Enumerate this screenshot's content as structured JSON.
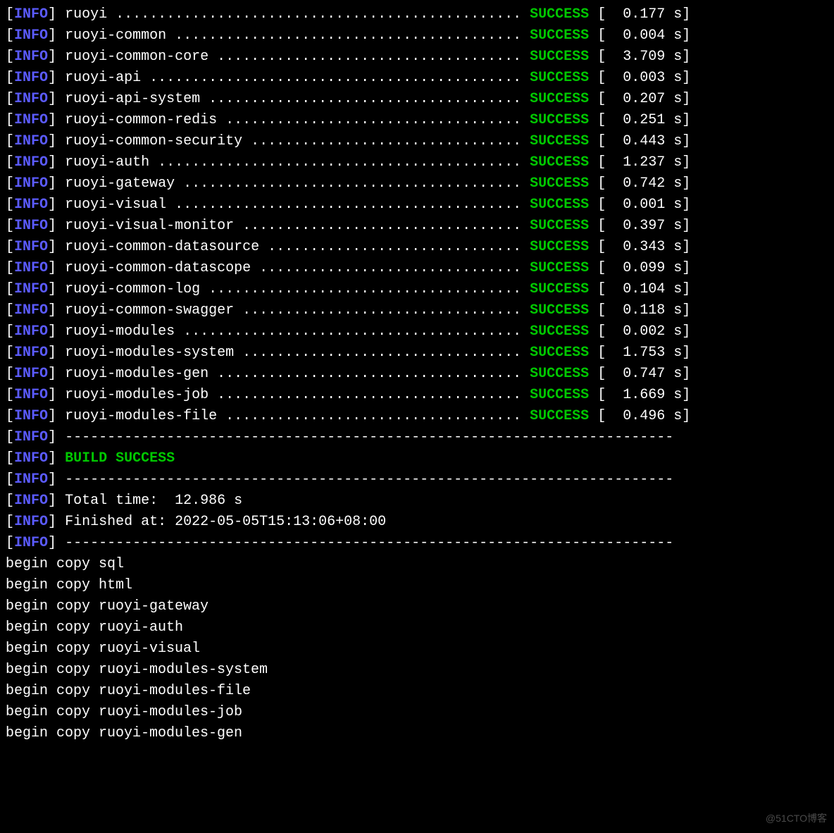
{
  "labels": {
    "info": "INFO",
    "success": "SUCCESS",
    "open": "[",
    "close": "]",
    "s": "s"
  },
  "modules": [
    {
      "name": "ruoyi",
      "time": "0.177"
    },
    {
      "name": "ruoyi-common",
      "time": "0.004"
    },
    {
      "name": "ruoyi-common-core",
      "time": "3.709"
    },
    {
      "name": "ruoyi-api",
      "time": "0.003"
    },
    {
      "name": "ruoyi-api-system",
      "time": "0.207"
    },
    {
      "name": "ruoyi-common-redis",
      "time": "0.251"
    },
    {
      "name": "ruoyi-common-security",
      "time": "0.443"
    },
    {
      "name": "ruoyi-auth",
      "time": "1.237"
    },
    {
      "name": "ruoyi-gateway",
      "time": "0.742"
    },
    {
      "name": "ruoyi-visual",
      "time": "0.001"
    },
    {
      "name": "ruoyi-visual-monitor",
      "time": "0.397"
    },
    {
      "name": "ruoyi-common-datasource",
      "time": "0.343"
    },
    {
      "name": "ruoyi-common-datascope",
      "time": "0.099"
    },
    {
      "name": "ruoyi-common-log",
      "time": "0.104"
    },
    {
      "name": "ruoyi-common-swagger",
      "time": "0.118"
    },
    {
      "name": "ruoyi-modules",
      "time": "0.002"
    },
    {
      "name": "ruoyi-modules-system",
      "time": "1.753"
    },
    {
      "name": "ruoyi-modules-gen",
      "time": "0.747"
    },
    {
      "name": "ruoyi-modules-job",
      "time": "1.669"
    },
    {
      "name": "ruoyi-modules-file",
      "time": "0.496"
    }
  ],
  "summary": {
    "rule": "------------------------------------------------------------------------",
    "build_success": "BUILD SUCCESS",
    "total_time_label": "Total time:  ",
    "total_time_value": "12.986 s",
    "finished_label": "Finished at: ",
    "finished_value": "2022-05-05T15:13:06+08:00"
  },
  "copy_lines": [
    "begin copy sql",
    "begin copy html",
    "begin copy ruoyi-gateway",
    "begin copy ruoyi-auth",
    "begin copy ruoyi-visual",
    "begin copy ruoyi-modules-system",
    "begin copy ruoyi-modules-file",
    "begin copy ruoyi-modules-job",
    "begin copy ruoyi-modules-gen"
  ],
  "watermark": "@51CTO博客"
}
